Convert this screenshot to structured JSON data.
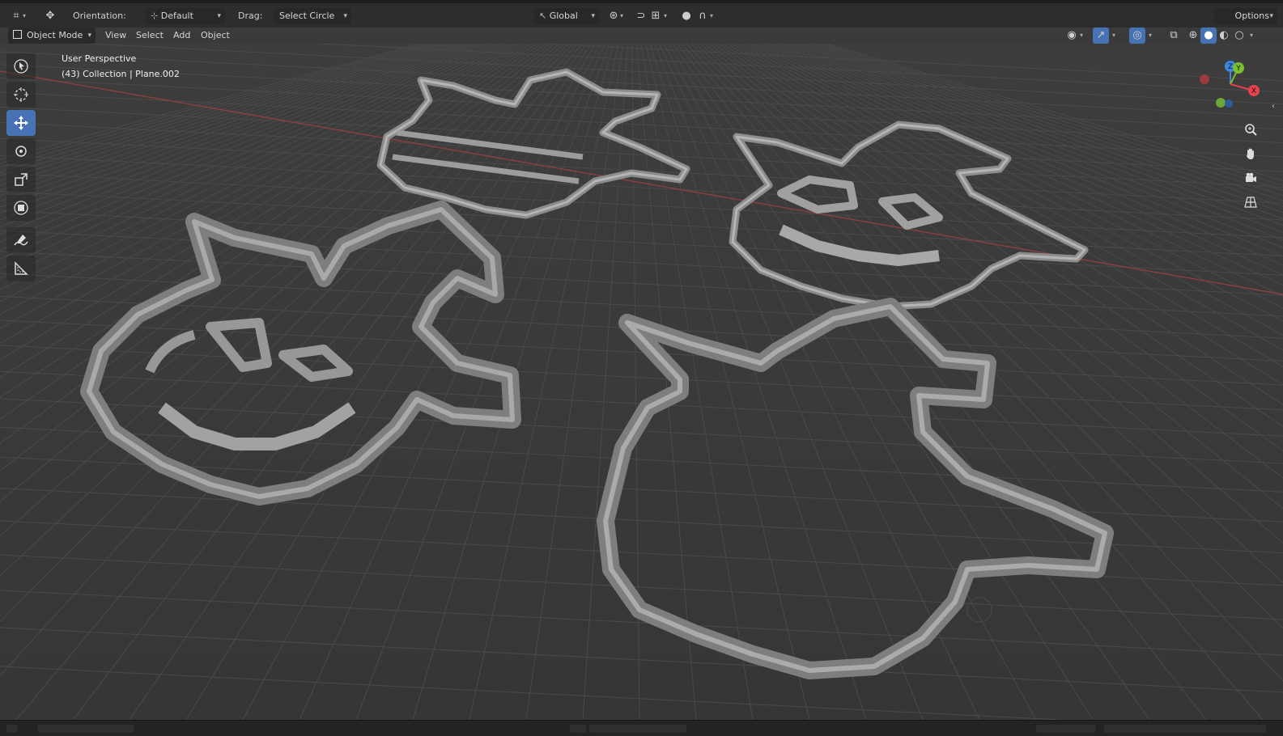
{
  "header": {
    "orientation_label": "Orientation:",
    "orientation_value": "Default",
    "drag_label": "Drag:",
    "drag_value": "Select Circle",
    "transform_space": "Global",
    "options_label": "Options"
  },
  "menubar": {
    "mode": "Object Mode",
    "menus": [
      "View",
      "Select",
      "Add",
      "Object"
    ]
  },
  "viewport": {
    "view_name": "User Perspective",
    "collection_info": "(43) Collection | Plane.002"
  },
  "gizmo": {
    "x_label": "X",
    "y_label": "Y",
    "z_label": "Z"
  },
  "toolbar": {
    "tools": [
      "tweak-tool",
      "cursor-tool",
      "move-tool",
      "rotate-tool",
      "scale-tool",
      "transform-tool",
      "annotate-tool",
      "measure-tool"
    ],
    "active_tool": "move-tool"
  },
  "colors": {
    "accent": "#4772b3",
    "background": "#3a3a3a",
    "grid_line": "#4a4a4a",
    "x_axis": "#b84a4a",
    "mesh": "#9a9a9a",
    "gizmo_x": "#e8424e",
    "gizmo_y": "#7bbf2a",
    "gizmo_z": "#3d87e0"
  }
}
